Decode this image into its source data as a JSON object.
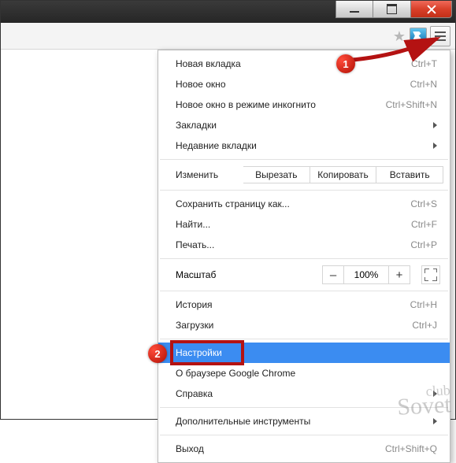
{
  "window": {
    "minimize": "Minimize",
    "maximize": "Maximize",
    "close": "Close"
  },
  "toolbar": {
    "bookmark_star": "Bookmark",
    "extension": "Extension",
    "menu": "Menu"
  },
  "menu": {
    "new_tab": {
      "label": "Новая вкладка",
      "shortcut": "Ctrl+T"
    },
    "new_window": {
      "label": "Новое окно",
      "shortcut": "Ctrl+N"
    },
    "incognito": {
      "label": "Новое окно в режиме инкогнито",
      "shortcut": "Ctrl+Shift+N"
    },
    "bookmarks": {
      "label": "Закладки"
    },
    "recent_tabs": {
      "label": "Недавние вкладки"
    },
    "edit_label": "Изменить",
    "cut": "Вырезать",
    "copy": "Копировать",
    "paste": "Вставить",
    "save_as": {
      "label": "Сохранить страницу как...",
      "shortcut": "Ctrl+S"
    },
    "find": {
      "label": "Найти...",
      "shortcut": "Ctrl+F"
    },
    "print": {
      "label": "Печать...",
      "shortcut": "Ctrl+P"
    },
    "zoom_label": "Масштаб",
    "zoom_minus": "–",
    "zoom_value": "100%",
    "zoom_plus": "+",
    "history": {
      "label": "История",
      "shortcut": "Ctrl+H"
    },
    "downloads": {
      "label": "Загрузки",
      "shortcut": "Ctrl+J"
    },
    "settings": {
      "label": "Настройки"
    },
    "about": {
      "label": "О браузере Google Chrome"
    },
    "help": {
      "label": "Справка"
    },
    "more_tools": {
      "label": "Дополнительные инструменты"
    },
    "exit": {
      "label": "Выход",
      "shortcut": "Ctrl+Shift+Q"
    }
  },
  "annotations": {
    "badge1": "1",
    "badge2": "2"
  },
  "watermark": {
    "line1": "club",
    "line2": "Sovet"
  }
}
